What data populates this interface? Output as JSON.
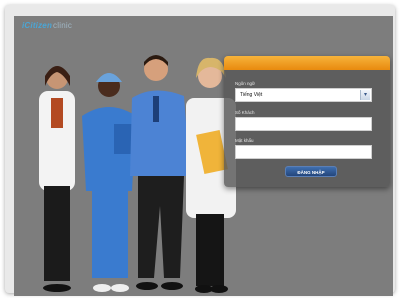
{
  "logo": {
    "brand": "iCitizen",
    "suffix": "clinic"
  },
  "login": {
    "language_label": "Ngôn ngữ",
    "language_value": "Tiếng Việt",
    "username_label": "Số Khách",
    "username_value": "",
    "password_label": "Mật khẩu",
    "password_value": "",
    "submit_label": "ĐĂNG NHẬP",
    "accent_color": "#f0a020",
    "button_color": "#2f5a96"
  }
}
